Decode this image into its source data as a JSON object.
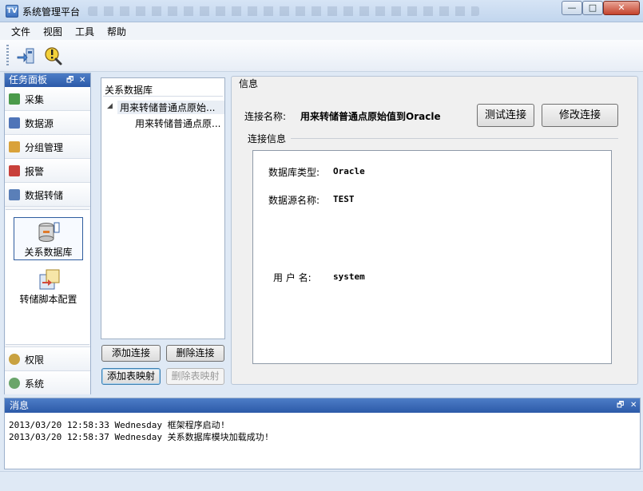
{
  "window": {
    "title": "系统管理平台",
    "icon_text": "TV",
    "controls": {
      "minimize": "—",
      "maximize": "□",
      "close": "✕"
    }
  },
  "menu": [
    "文件",
    "视图",
    "工具",
    "帮助"
  ],
  "toolbar": {
    "icons": [
      "connect-icon",
      "warning-search-icon"
    ]
  },
  "task_panel": {
    "title": "任务面板",
    "pin": "🗗",
    "close": "✕",
    "sections": [
      {
        "label": "采集",
        "color": "#4a9a4a"
      },
      {
        "label": "数据源",
        "color": "#4f74b8"
      },
      {
        "label": "分组管理",
        "color": "#d9a23a"
      },
      {
        "label": "报警",
        "color": "#c8403a"
      },
      {
        "label": "数据转储",
        "color": "#5a7fb8"
      }
    ],
    "tiles": [
      {
        "label": "关系数据库",
        "selected": true
      },
      {
        "label": "转储脚本配置",
        "selected": false
      }
    ],
    "bottom_sections": [
      {
        "label": "权限",
        "color": "#c9a240"
      },
      {
        "label": "系统",
        "color": "#6aa56a"
      }
    ]
  },
  "tree": {
    "title": "关系数据库",
    "nodes": [
      {
        "label": "用来转储普通点原始..."
      },
      {
        "label": "用来转储普通点原..."
      }
    ],
    "buttons": {
      "add_connection": "添加连接",
      "delete_connection": "删除连接",
      "add_table_mapping": "添加表映射",
      "delete_table_mapping": "删除表映射"
    }
  },
  "info": {
    "title": "信息",
    "connection_name_label": "连接名称:",
    "connection_name_value": "用来转储普通点原始值到Oracle",
    "test_button": "测试连接",
    "edit_button": "修改连接",
    "group_title": "连接信息",
    "db_type_label": "数据库类型:",
    "db_type_value": "Oracle",
    "ds_name_label": "数据源名称:",
    "ds_name_value": "TEST",
    "user_label": "用 户 名:",
    "user_value": "system"
  },
  "messages": {
    "title": "消息",
    "pin": "🗗",
    "close": "✕",
    "lines": [
      "2013/03/20 12:58:33 Wednesday 框架程序启动!",
      "2013/03/20 12:58:37 Wednesday 关系数据库模块加载成功!"
    ]
  }
}
